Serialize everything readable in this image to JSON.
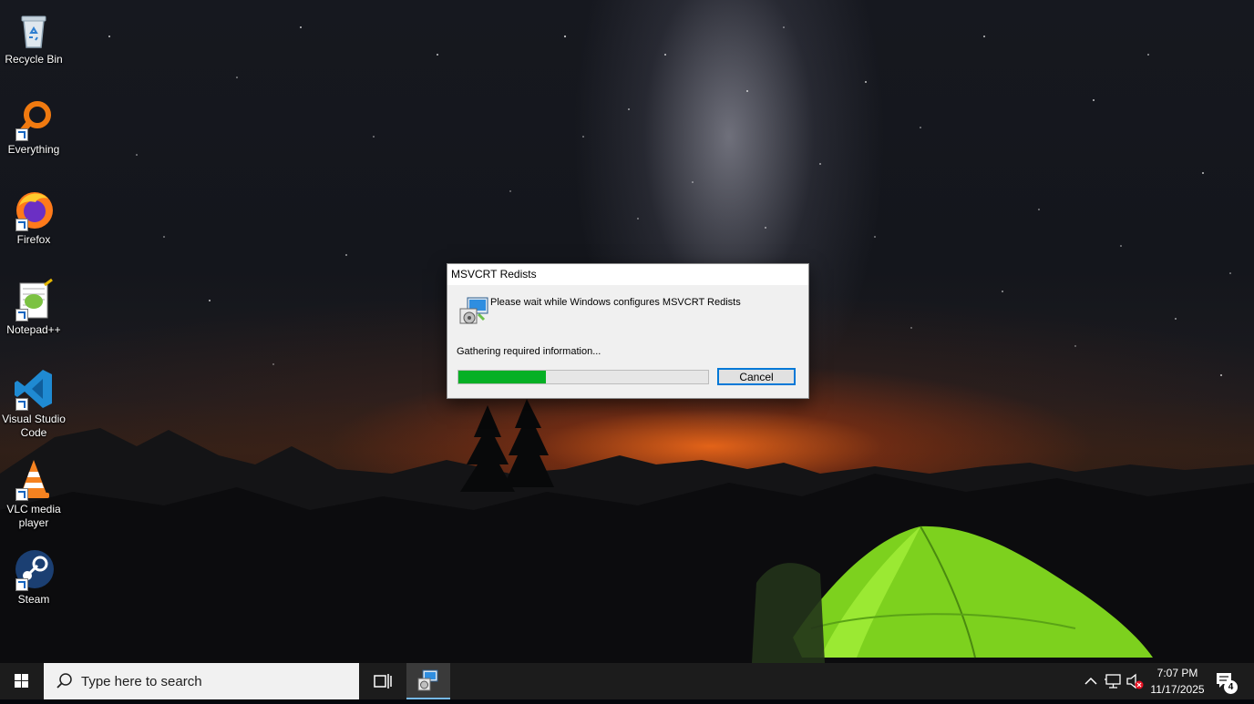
{
  "desktop": {
    "icons": [
      {
        "label": "Recycle Bin",
        "icon": "recycle-bin-icon"
      },
      {
        "label": "Everything",
        "icon": "everything-search-icon"
      },
      {
        "label": "Firefox",
        "icon": "firefox-icon"
      },
      {
        "label": "Notepad++",
        "icon": "notepad-plus-plus-icon"
      },
      {
        "label": "Visual Studio Code",
        "icon": "vscode-icon"
      },
      {
        "label": "VLC media player",
        "icon": "vlc-icon"
      },
      {
        "label": "Steam",
        "icon": "steam-icon"
      }
    ]
  },
  "dialog": {
    "title": "MSVCRT Redists",
    "message": "Please wait while Windows configures MSVCRT Redists",
    "status": "Gathering required information...",
    "progress_fraction": 0.35,
    "progress_color": "#06b025",
    "cancel_label": "Cancel",
    "icon": "installer-icon"
  },
  "taskbar": {
    "search_placeholder": "Type here to search",
    "clock_time": "7:07 PM",
    "clock_date": "11/17/2025",
    "notification_count": "4",
    "icons": [
      "windows-start-icon",
      "search-icon",
      "task-view-icon",
      "installer-icon",
      "chevron-up-icon",
      "network-icon",
      "volume-muted-icon",
      "action-center-icon"
    ]
  }
}
